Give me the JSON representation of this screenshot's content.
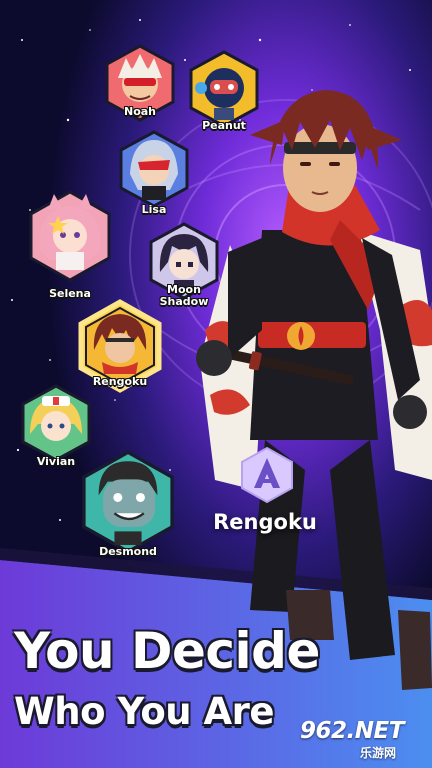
{
  "roster": [
    {
      "id": "noah",
      "name": "Noah",
      "hex_color": "#ef6b6f",
      "skin": "#f2c9a0",
      "hair": "#f4efe6"
    },
    {
      "id": "peanut",
      "name": "Peanut",
      "hex_color": "#f3bc2b",
      "skin": "#d94f4f",
      "hair": "#1d2f5e"
    },
    {
      "id": "lisa",
      "name": "Lisa",
      "hex_color": "#5b7fe0",
      "skin": "#f5d3b8",
      "hair": "#c9d3e8"
    },
    {
      "id": "selena",
      "name": "Selena",
      "hex_color": "#f2a4b6",
      "skin": "#fbe0d2",
      "hair": "#f4a6bd"
    },
    {
      "id": "moon_shadow",
      "name": "Moon\nShadow",
      "hex_color": "#cfc7ea",
      "skin": "#f7e1d4",
      "hair": "#2a2440"
    },
    {
      "id": "rengoku",
      "name": "Rengoku",
      "hex_color": "#f4b835",
      "skin": "#f0c6a2",
      "hair": "#7a2a20",
      "selected": true
    },
    {
      "id": "vivian",
      "name": "Vivian",
      "hex_color": "#63c48a",
      "skin": "#fbe2cf",
      "hair": "#f2d05a"
    },
    {
      "id": "desmond",
      "name": "Desmond",
      "hex_color": "#3fb7a8",
      "skin": "#7fa7a9",
      "hair": "#2c2a2a"
    }
  ],
  "selected_character": {
    "name": "Rengoku",
    "class_icon": "a-class-badge-icon"
  },
  "headline": {
    "line1": "You Decide",
    "line2": "Who You Are"
  },
  "watermark": {
    "main": "962.NET",
    "sub": "乐游网"
  },
  "colors": {
    "accent_purple": "#8a3cf0",
    "selected_glow": "#ffd34d",
    "badge": "#c9b9ff"
  }
}
